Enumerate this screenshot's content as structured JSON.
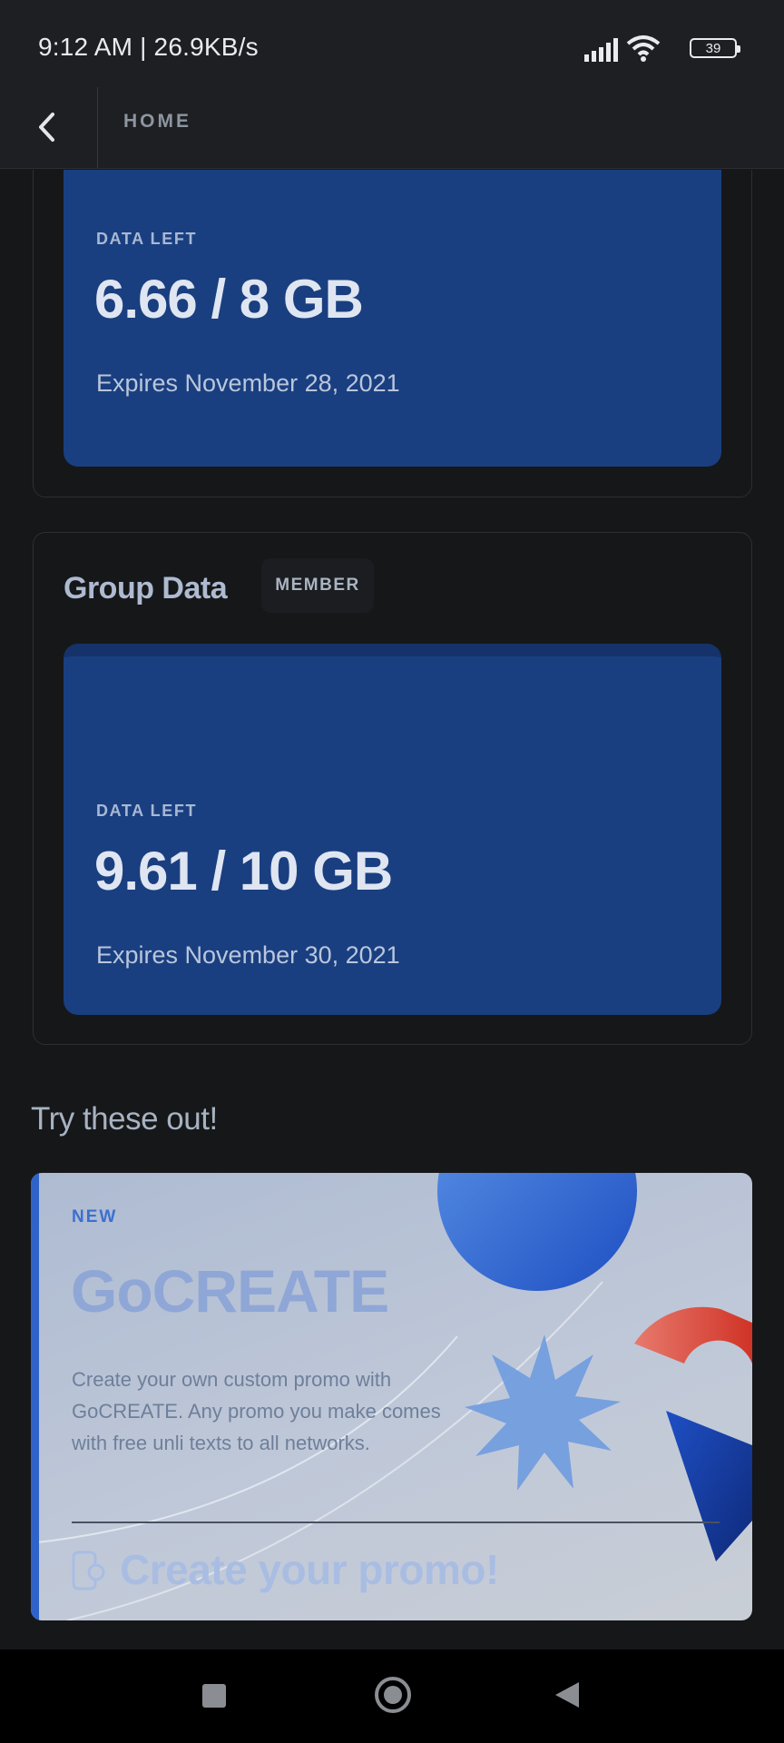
{
  "status_bar": {
    "time_speed": "9:12 AM | 26.9KB/s",
    "battery_level": "39",
    "icons": [
      "signal-icon",
      "wifi-icon",
      "battery-icon"
    ]
  },
  "header": {
    "title": "HOME",
    "back_icon": "chevron-left-icon"
  },
  "personal_data": {
    "label": "DATA LEFT",
    "value": "6.66 / 8 GB",
    "expiry": "Expires November 28, 2021"
  },
  "group_data": {
    "title": "Group Data",
    "badge": "MEMBER",
    "label": "DATA LEFT",
    "value": "9.61 / 10 GB",
    "expiry": "Expires November 30, 2021"
  },
  "promos": {
    "section_title": "Try these out!",
    "card": {
      "tag": "NEW",
      "title": "GoCREATE",
      "description": "Create your own custom promo with GoCREATE. Any promo you make comes with free unli texts to all networks.",
      "cta": "Create your promo!",
      "cta_icon": "phone-promo-icon"
    }
  },
  "nav_bar": {
    "icons": [
      "recents-square-icon",
      "home-circle-icon",
      "back-triangle-icon"
    ]
  },
  "colors": {
    "background": "#161719",
    "data_panel": "#1a3f80",
    "accent_blue": "#2f63c9",
    "promo_red": "#d9453a"
  }
}
